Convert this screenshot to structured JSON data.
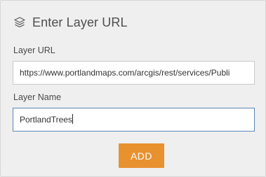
{
  "dialog": {
    "title": "Enter Layer URL",
    "icon": "layers-icon"
  },
  "form": {
    "layer_url": {
      "label": "Layer URL",
      "value": "https://www.portlandmaps.com/arcgis/rest/services/Publi"
    },
    "layer_name": {
      "label": "Layer Name",
      "value": "PortlandTrees"
    },
    "add_label": "ADD"
  },
  "colors": {
    "panel_bg": "#efefef",
    "accent": "#e8912f",
    "focus_border": "#5a87b8"
  }
}
